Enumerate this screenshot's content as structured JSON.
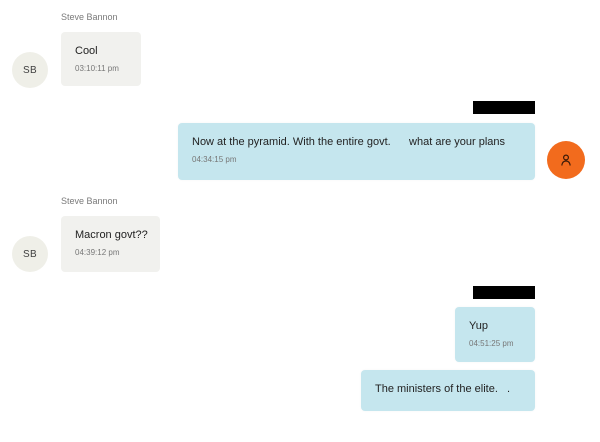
{
  "colors": {
    "incoming_bubble": "#f1f1ee",
    "outgoing_bubble": "#c5e6ee",
    "user_avatar": "#f26b1d",
    "redaction": "#000000"
  },
  "messages": [
    {
      "direction": "incoming",
      "sender_name": "Steve Bannon",
      "avatar_initials": "SB",
      "text": "Cool",
      "time": "03:10:11 pm"
    },
    {
      "direction": "outgoing",
      "avatar_icon": "person-icon",
      "sender_redacted": true,
      "text": "Now at the pyramid. With the entire govt.      what are your plans",
      "time": "04:34:15 pm"
    },
    {
      "direction": "incoming",
      "sender_name": "Steve Bannon",
      "avatar_initials": "SB",
      "text": "Macron govt??",
      "time": "04:39:12 pm"
    },
    {
      "direction": "outgoing",
      "sender_redacted": true,
      "text": "Yup",
      "time": "04:51:25 pm"
    },
    {
      "direction": "outgoing",
      "text": "The ministers of the elite.   ."
    }
  ]
}
